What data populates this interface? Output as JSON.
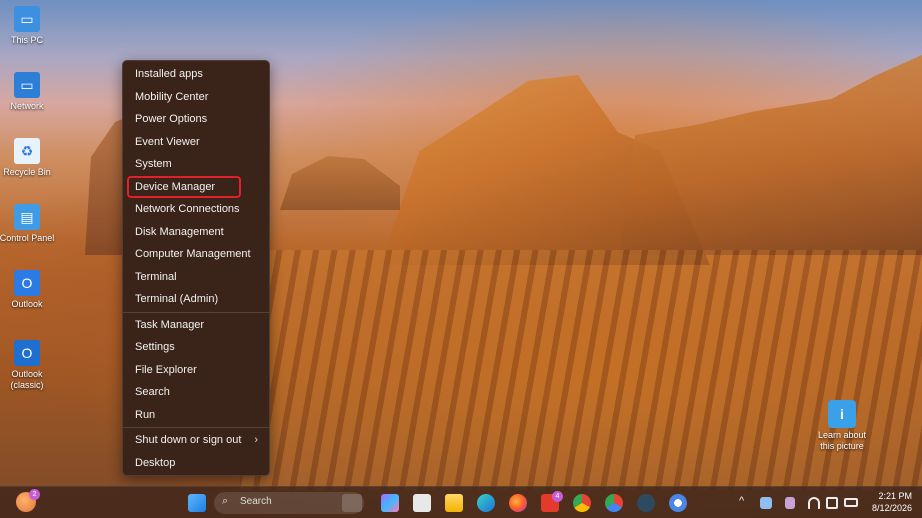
{
  "desktop_icons": [
    {
      "name": "this-pc",
      "label": "This PC",
      "icon": "monitor-icon",
      "color": "#3d8fe0"
    },
    {
      "name": "network",
      "label": "Network",
      "icon": "network-icon",
      "color": "#2d7ed6"
    },
    {
      "name": "recycle-bin",
      "label": "Recycle Bin",
      "icon": "recycle-bin-icon",
      "color": "#6fb6e8"
    },
    {
      "name": "control-panel",
      "label": "Control Panel",
      "icon": "control-panel-icon",
      "color": "#3f9be6"
    },
    {
      "name": "outlook",
      "label": "Outlook",
      "icon": "outlook-icon",
      "color": "#2c7be5"
    },
    {
      "name": "outlook-classic",
      "label": "Outlook (classic)",
      "icon": "outlook-classic-icon",
      "color": "#1f6fd1"
    }
  ],
  "context_menu": {
    "group1": [
      "Installed apps",
      "Mobility Center",
      "Power Options",
      "Event Viewer",
      "System",
      "Device Manager",
      "Network Connections",
      "Disk Management",
      "Computer Management",
      "Terminal",
      "Terminal (Admin)"
    ],
    "group2": [
      "Task Manager",
      "Settings",
      "File Explorer",
      "Search",
      "Run"
    ],
    "group3": [
      "Shut down or sign out",
      "Desktop"
    ],
    "submenu_chevron": "›",
    "highlighted": "Device Manager"
  },
  "learn_about_picture": {
    "label": "Learn about this picture",
    "icon": "info-icon",
    "glyph": "i"
  },
  "taskbar": {
    "start_icon": "windows-start-icon",
    "search_placeholder": "Search",
    "search_glyph": "⌕",
    "weather_badge": "2",
    "app_badge": "4",
    "tray_chevron": "^",
    "time": "2:21 PM",
    "date": "8/12/2026"
  }
}
